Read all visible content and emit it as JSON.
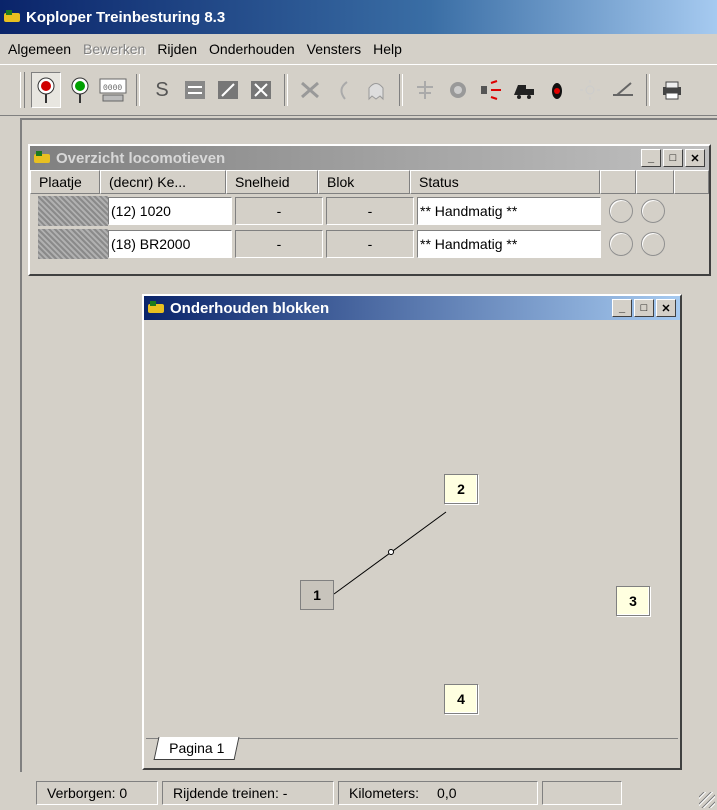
{
  "app": {
    "title": "Koploper Treinbesturing 8.3"
  },
  "menu": [
    {
      "label": "Algemeen",
      "enabled": true
    },
    {
      "label": "Bewerken",
      "enabled": false
    },
    {
      "label": "Rijden",
      "enabled": true
    },
    {
      "label": "Onderhouden",
      "enabled": true
    },
    {
      "label": "Vensters",
      "enabled": true
    },
    {
      "label": "Help",
      "enabled": true
    }
  ],
  "toolbar": {
    "icons": [
      "signal-red-icon",
      "signal-green-icon",
      "locomotive-address-icon",
      "s-icon",
      "block-icon",
      "edit-block-icon",
      "delete-block-icon",
      "tools-icon",
      "curve-icon",
      "ghost-icon",
      "crossing-icon",
      "sensor-icon",
      "sound-icon",
      "locomotive-icon",
      "stop-light-icon",
      "sun-icon",
      "turnout-icon",
      "print-icon"
    ],
    "loco_address_label": "0000",
    "s_label": "S"
  },
  "loco_window": {
    "title": "Overzicht locomotieven",
    "columns": [
      "Plaatje",
      "(decnr) Ke...",
      "Snelheid",
      "Blok",
      "Status"
    ],
    "rows": [
      {
        "name": "(12) 1020",
        "speed": "-",
        "block": "-",
        "status": "** Handmatig **"
      },
      {
        "name": "(18) BR2000",
        "speed": "-",
        "block": "-",
        "status": "** Handmatig **"
      }
    ]
  },
  "blocks_window": {
    "title": "Onderhouden blokken",
    "blocks": [
      {
        "label": "1",
        "style": "grey"
      },
      {
        "label": "2",
        "style": "yellow"
      },
      {
        "label": "3",
        "style": "yellow"
      },
      {
        "label": "4",
        "style": "yellow"
      }
    ],
    "tab": "Pagina 1"
  },
  "status": {
    "hidden": "Verborgen: 0",
    "riding": "Rijdende treinen: -",
    "km_label": "Kilometers:",
    "km_value": "0,0"
  },
  "window_buttons": {
    "minimize": "_",
    "maximize": "□",
    "close": "✕"
  },
  "colors": {
    "title_active": "#0a246a",
    "title_inactive": "#808080",
    "block_yellow": "#ffffe0"
  }
}
